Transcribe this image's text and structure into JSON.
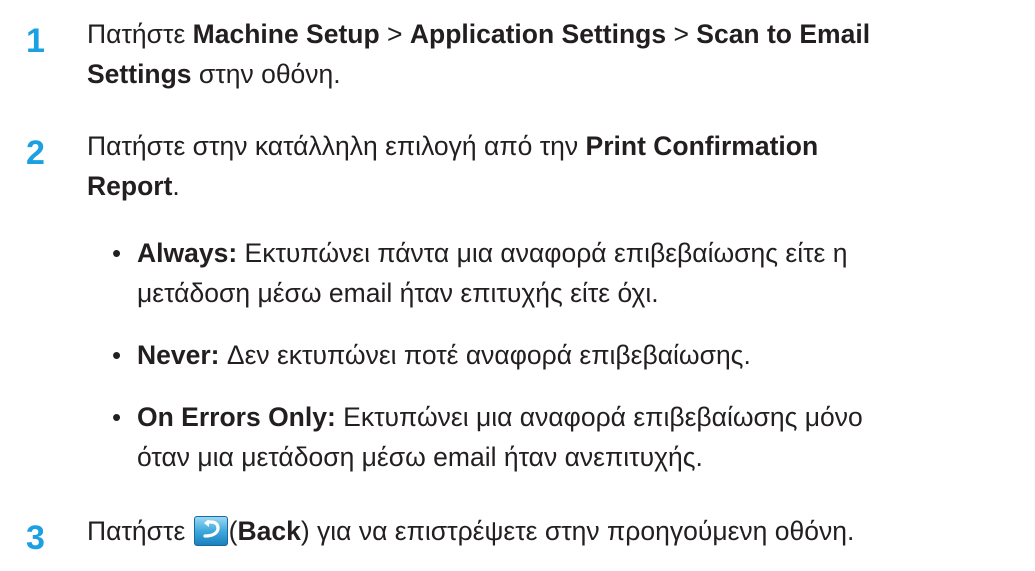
{
  "steps": [
    {
      "number": "1",
      "prefix": "Πατήστε ",
      "menu1": "Machine Setup",
      "sep1": " > ",
      "menu2": "Application Settings",
      "sep2": " > ",
      "menu3_a": "Scan to Email",
      "menu3_b": "Settings",
      "suffix": " στην οθόνη."
    },
    {
      "number": "2",
      "prefix": "Πατήστε στην κατάλληλη επιλογή από την ",
      "option_a": "Print Confirmation",
      "option_b": "Report",
      "suffix": "."
    },
    {
      "number": "3",
      "prefix": "Πατήστε ",
      "paren_open": "(",
      "button_label": "Back",
      "suffix": ") για να επιστρέψετε στην προηγούμενη οθόνη."
    }
  ],
  "bullets": [
    {
      "dot": "•",
      "label": "Always:",
      "line1": " Εκτυπώνει πάντα μια αναφορά επιβεβαίωσης είτε η",
      "line2": "μετάδοση μέσω email ήταν επιτυχής είτε όχι."
    },
    {
      "dot": "•",
      "label": "Never:",
      "line1": " Δεν εκτυπώνει ποτέ αναφορά επιβεβαίωσης."
    },
    {
      "dot": "•",
      "label": "On Errors Only:",
      "line1": " Εκτυπώνει μια αναφορά επιβεβαίωσης μόνο",
      "line2": "όταν μια μετάδοση μέσω email ήταν ανεπιτυχής."
    }
  ],
  "icons": {
    "back": "back-arrow-icon"
  },
  "colors": {
    "step_number": "#1ba1e2",
    "text": "#231f20"
  }
}
